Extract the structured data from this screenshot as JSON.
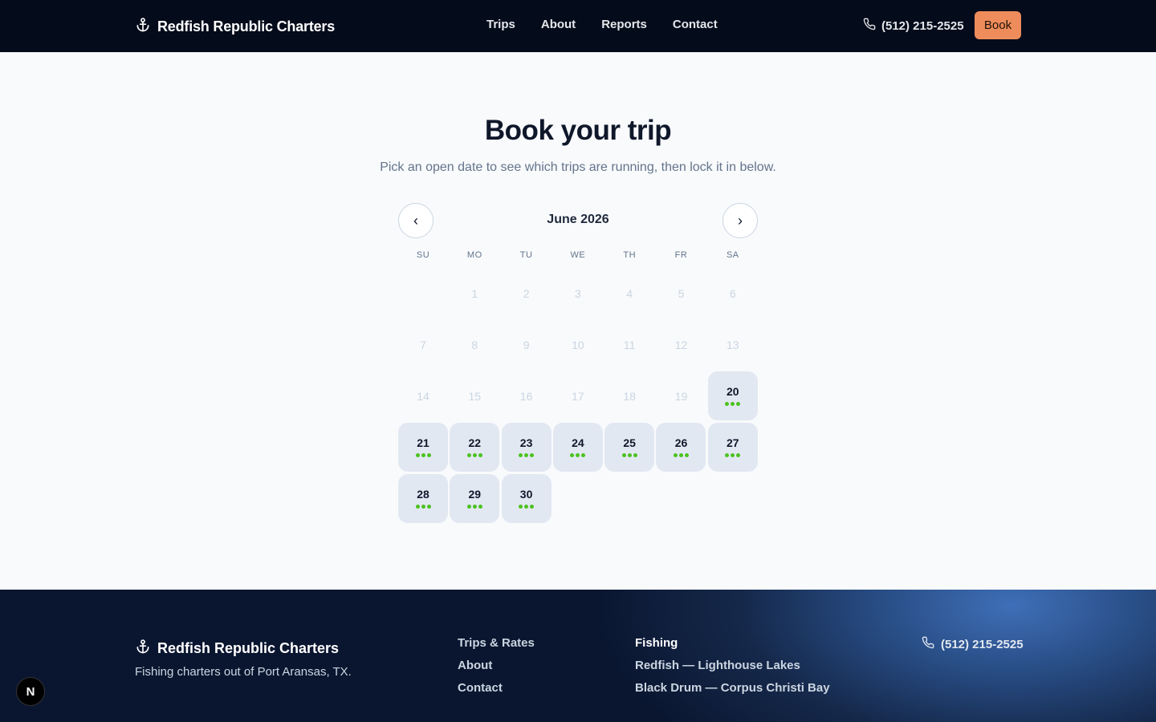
{
  "header": {
    "brand": "Redfish Republic Charters",
    "nav": [
      "Trips",
      "About",
      "Reports",
      "Contact"
    ],
    "phone": "(512) 215-2525",
    "book_label": "Book"
  },
  "main": {
    "title": "Book your trip",
    "subtitle": "Pick an open date to see which trips are running, then lock it in below.",
    "calendar": {
      "month_label": "June 2026",
      "prev_label": "‹",
      "next_label": "›",
      "weekdays": [
        "SU",
        "MO",
        "TU",
        "WE",
        "TH",
        "FR",
        "SA"
      ],
      "leading_blanks": 1,
      "days": [
        {
          "d": "1",
          "state": "past"
        },
        {
          "d": "2",
          "state": "past"
        },
        {
          "d": "3",
          "state": "past"
        },
        {
          "d": "4",
          "state": "past"
        },
        {
          "d": "5",
          "state": "past"
        },
        {
          "d": "6",
          "state": "past"
        },
        {
          "d": "7",
          "state": "past"
        },
        {
          "d": "8",
          "state": "past"
        },
        {
          "d": "9",
          "state": "past"
        },
        {
          "d": "10",
          "state": "past"
        },
        {
          "d": "11",
          "state": "past"
        },
        {
          "d": "12",
          "state": "past"
        },
        {
          "d": "13",
          "state": "past"
        },
        {
          "d": "14",
          "state": "past"
        },
        {
          "d": "15",
          "state": "past"
        },
        {
          "d": "16",
          "state": "past"
        },
        {
          "d": "17",
          "state": "past"
        },
        {
          "d": "18",
          "state": "past"
        },
        {
          "d": "19",
          "state": "past"
        },
        {
          "d": "20",
          "state": "open",
          "trips": 3
        },
        {
          "d": "21",
          "state": "open",
          "trips": 3
        },
        {
          "d": "22",
          "state": "open",
          "trips": 3
        },
        {
          "d": "23",
          "state": "open",
          "trips": 3
        },
        {
          "d": "24",
          "state": "open",
          "trips": 3
        },
        {
          "d": "25",
          "state": "open",
          "trips": 3
        },
        {
          "d": "26",
          "state": "open",
          "trips": 3
        },
        {
          "d": "27",
          "state": "open",
          "trips": 3
        },
        {
          "d": "28",
          "state": "open",
          "trips": 3
        },
        {
          "d": "29",
          "state": "open",
          "trips": 3
        },
        {
          "d": "30",
          "state": "open",
          "trips": 3
        }
      ],
      "dot_color": "#4cc21f"
    }
  },
  "footer": {
    "brand": "Redfish Republic Charters",
    "tagline": "Fishing charters out of Port Aransas, TX.",
    "links": [
      "Trips & Rates",
      "About",
      "Contact"
    ],
    "fishing_heading": "Fishing",
    "fishing_links": [
      "Redfish — Lighthouse Lakes",
      "Black Drum — Corpus Christi Bay"
    ],
    "phone": "(512) 215-2525"
  },
  "badge": "N",
  "colors": {
    "accent": "#ee8c5b",
    "header_bg": "#040b1a",
    "open_day_bg": "#e2e8f2"
  }
}
